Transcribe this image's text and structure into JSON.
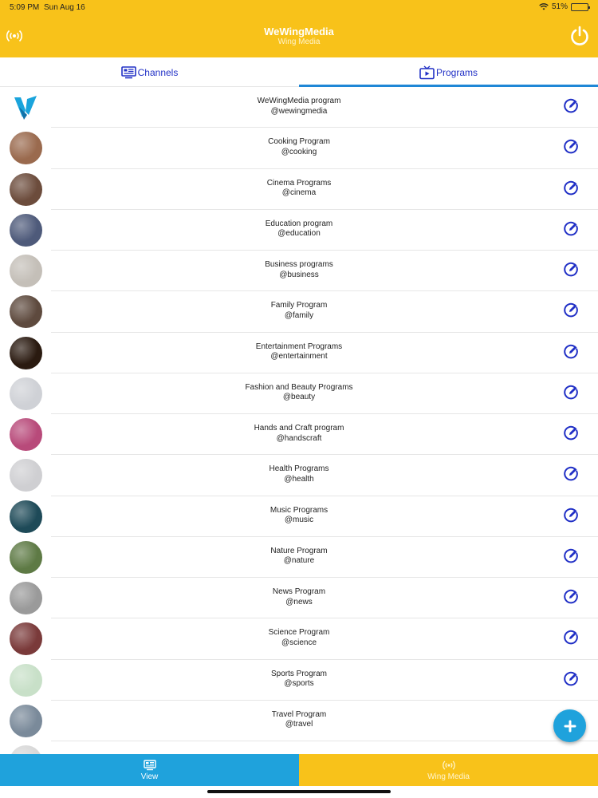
{
  "status": {
    "time": "5:09 PM",
    "date": "Sun Aug 16",
    "battery": "51%",
    "battery_level": 0.51
  },
  "header": {
    "title": "WeWingMedia",
    "subtitle": "Wing Media",
    "left_icon": "broadcast-icon",
    "right_icon": "power-icon"
  },
  "tabs": [
    {
      "label": "Channels",
      "icon": "channels-icon",
      "active": false
    },
    {
      "label": "Programs",
      "icon": "tv-play-icon",
      "active": true
    }
  ],
  "programs": [
    {
      "name": "WeWingMedia program",
      "handle": "@wewingmedia",
      "color": "#1aa4dc"
    },
    {
      "name": "Cooking Program",
      "handle": "@cooking",
      "color": "#9a6a4e"
    },
    {
      "name": "Cinema Programs",
      "handle": "@cinema",
      "color": "#6c4c3c"
    },
    {
      "name": "Education program",
      "handle": "@education",
      "color": "#4e5a7a"
    },
    {
      "name": "Business programs",
      "handle": "@business",
      "color": "#c4bfb8"
    },
    {
      "name": "Family Program",
      "handle": "@family",
      "color": "#5e4a3e"
    },
    {
      "name": "Entertainment Programs",
      "handle": "@entertainment",
      "color": "#2a1a10"
    },
    {
      "name": "Fashion and Beauty Programs",
      "handle": "@beauty",
      "color": "#cfd1d6"
    },
    {
      "name": "Hands and Craft program",
      "handle": "@handscraft",
      "color": "#b84a7a"
    },
    {
      "name": "Health Programs",
      "handle": "@health",
      "color": "#cfcfd2"
    },
    {
      "name": "Music Programs",
      "handle": "@music",
      "color": "#1e4a58"
    },
    {
      "name": "Nature Program",
      "handle": "@nature",
      "color": "#5e7a45"
    },
    {
      "name": "News Program",
      "handle": "@news",
      "color": "#9a9a9a"
    },
    {
      "name": "Science Program",
      "handle": "@science",
      "color": "#7a3a3a"
    },
    {
      "name": "Sports Program",
      "handle": "@sports",
      "color": "#c8e0c8"
    },
    {
      "name": "Travel Program",
      "handle": "@travel",
      "color": "#7a8a9a"
    },
    {
      "name": "",
      "handle": "",
      "color": "#d8d8d8"
    }
  ],
  "fab": {
    "icon": "plus-icon"
  },
  "bottom_tabs": [
    {
      "label": "View",
      "icon": "view-icon"
    },
    {
      "label": "Wing Media",
      "icon": "broadcast-icon"
    }
  ],
  "colors": {
    "header": "#f8c21a",
    "accent_blue": "#1fa2dc",
    "tab_text": "#2130c6",
    "edit_icon": "#2130c6"
  }
}
